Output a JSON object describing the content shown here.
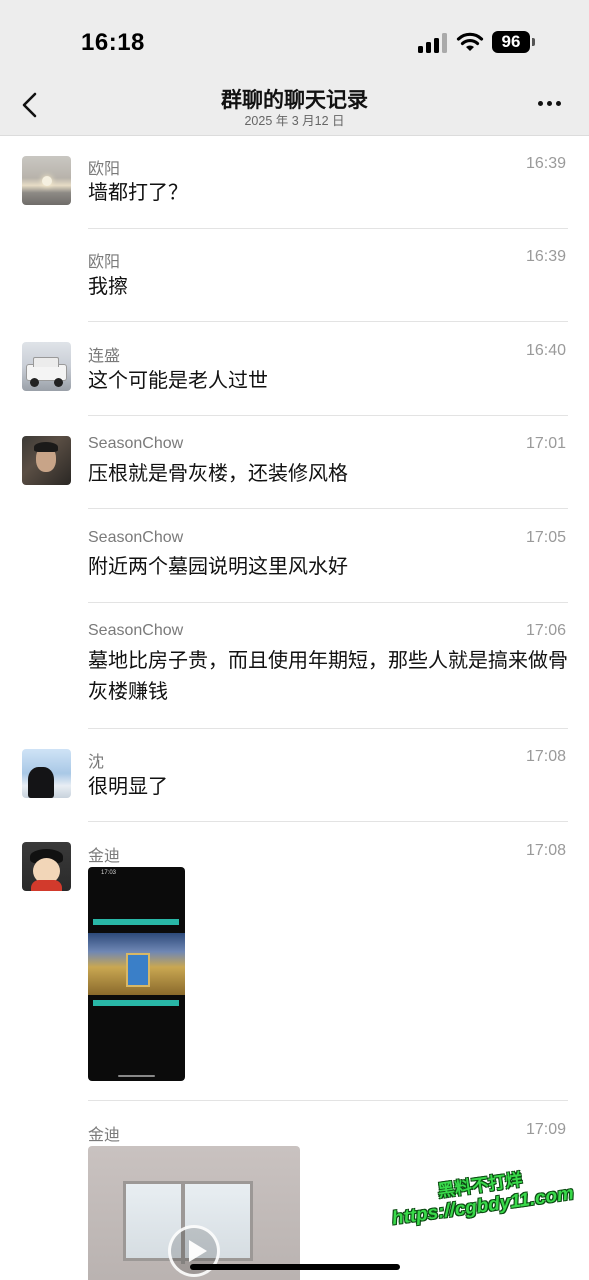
{
  "status_bar": {
    "time": "16:18",
    "battery": "96"
  },
  "header": {
    "title": "群聊的聊天记录",
    "date": "2025 年 3 月12 日"
  },
  "messages": [
    {
      "sender": "欧阳",
      "time": "16:39",
      "text": "墙都打了？"
    },
    {
      "sender": "欧阳",
      "time": "16:39",
      "text": "我擦"
    },
    {
      "sender": "连盛",
      "time": "16:40",
      "text": "这个可能是老人过世"
    },
    {
      "sender": "SeasonChow",
      "time": "17:01",
      "text": "压根就是骨灰楼，还装修风格"
    },
    {
      "sender": "SeasonChow",
      "time": "17:05",
      "text": "附近两个墓园说明这里风水好"
    },
    {
      "sender": "SeasonChow",
      "time": "17:06",
      "text": "墓地比房子贵，而且使用年期短，那些人就是搞来做骨灰楼赚钱"
    },
    {
      "sender": "沈",
      "time": "17:08",
      "text": "很明显了"
    },
    {
      "sender": "金迪",
      "time": "17:08",
      "type": "image",
      "image_text": "17:03"
    },
    {
      "sender": "金迪",
      "time": "17:09",
      "type": "video"
    }
  ],
  "watermark": {
    "line1": "黑料不打烊",
    "line2": "https://cgbdy11.com"
  }
}
